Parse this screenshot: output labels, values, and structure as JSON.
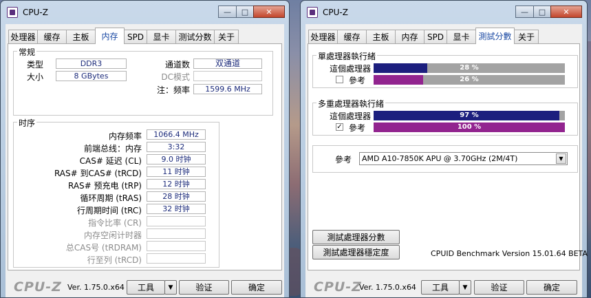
{
  "left_window": {
    "title": "CPU-Z",
    "tabs": [
      "处理器",
      "缓存",
      "主板",
      "内存",
      "SPD",
      "显卡",
      "测试分数",
      "关于"
    ],
    "active_tab": "内存",
    "general": {
      "heading": "常规",
      "type_label": "类型",
      "type_value": "DDR3",
      "size_label": "大小",
      "size_value": "8 GBytes",
      "channel_label": "通道数",
      "channel_value": "双通道",
      "dc_label": "DC模式",
      "dc_value": "",
      "nb_label": "注：频率",
      "nb_value": "1599.6 MHz"
    },
    "timings": {
      "heading": "时序",
      "rows": [
        {
          "label": "内存频率",
          "value": "1066.4 MHz",
          "disabled": false
        },
        {
          "label": "前端总线：内存",
          "value": "3:32",
          "disabled": false
        },
        {
          "label": "CAS# 延迟 (CL)",
          "value": "9.0 时钟",
          "disabled": false
        },
        {
          "label": "RAS# 到CAS# (tRCD)",
          "value": "11 时钟",
          "disabled": false
        },
        {
          "label": "RAS# 预充电 (tRP)",
          "value": "12 时钟",
          "disabled": false
        },
        {
          "label": "循环周期 (tRAS)",
          "value": "28 时钟",
          "disabled": false
        },
        {
          "label": "行周期时间 (tRC)",
          "value": "32 时钟",
          "disabled": false
        },
        {
          "label": "指令比率 (CR)",
          "value": "",
          "disabled": true
        },
        {
          "label": "内存空闲计时器",
          "value": "",
          "disabled": true
        },
        {
          "label": "总CAS号 (tRDRAM)",
          "value": "",
          "disabled": true
        },
        {
          "label": "行至列 (tRCD)",
          "value": "",
          "disabled": true
        }
      ]
    },
    "footer": {
      "logo": "CPU-Z",
      "version": "Ver. 1.75.0.x64",
      "tools_label": "工具",
      "tools_arrow": "▼",
      "validate_label": "验证",
      "ok_label": "确定"
    },
    "window_buttons": {
      "minimize": "—",
      "maximize": "□",
      "close": "✕"
    }
  },
  "right_window": {
    "title": "CPU-Z",
    "tabs": [
      "处理器",
      "缓存",
      "主板",
      "内存",
      "SPD",
      "显卡",
      "測試分數",
      "关于"
    ],
    "active_tab": "測試分數",
    "single": {
      "heading": "單處理器執行緒",
      "this_label": "這個處理器",
      "this_percent": 28,
      "this_text": "28 %",
      "ref_label": "參考",
      "ref_checked": false,
      "ref_percent": 26,
      "ref_text": "26 %"
    },
    "multi": {
      "heading": "多重處理器執行緒",
      "this_label": "這個處理器",
      "this_percent": 97,
      "this_text": "97 %",
      "ref_label": "參考",
      "ref_checked": true,
      "ref_check_mark": "✓",
      "ref_percent": 100,
      "ref_text": "100 %"
    },
    "reference": {
      "label": "參考",
      "selected": "AMD A10-7850K APU @ 3.70GHz (2M/4T)",
      "arrow": "▼"
    },
    "bench_button": "測試處理器分數",
    "stress_button": "測試處理器穩定度",
    "bench_version": "CPUID Benchmark Version 15.01.64 BETA",
    "footer": {
      "logo": "CPU-Z",
      "version": "Ver. 1.75.0.x64",
      "tools_label": "工具",
      "tools_arrow": "▼",
      "validate_label": "验证",
      "ok_label": "确定"
    },
    "window_buttons": {
      "minimize": "—",
      "maximize": "□",
      "close": "✕"
    }
  },
  "colors": {
    "this_cpu_bar": "#1c1f7e",
    "reference_bar": "#92248f",
    "bar_background": "#a3a3a3",
    "active_tab_text": "#1a49a3",
    "value_text": "#1b2a7a"
  }
}
